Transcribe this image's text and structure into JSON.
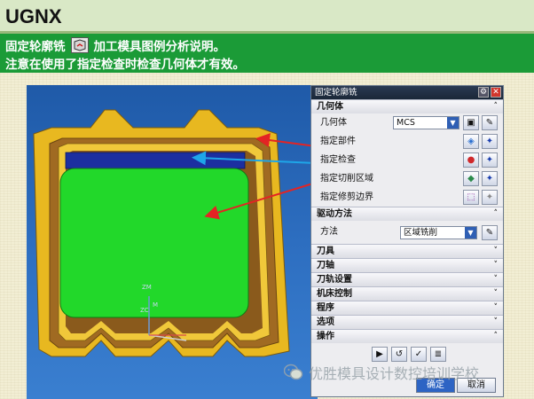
{
  "header": {
    "title": "UGNX"
  },
  "banner": {
    "line1_prefix": "固定轮廓铣",
    "line1_suffix": "加工模具图例分析说明。",
    "line2": "注意在使用了指定检查时检查几何体才有效。"
  },
  "viewport": {
    "axis_zm": "ZM",
    "axis_z": "ZC",
    "axis_m": "M"
  },
  "dialog": {
    "title": "固定轮廓铣",
    "geometry_section": "几何体",
    "geometry_label": "几何体",
    "geometry_value": "MCS",
    "specify_part": "指定部件",
    "specify_check": "指定检查",
    "specify_cut_area": "指定切削区域",
    "specify_trim": "指定修剪边界",
    "drive_section": "驱动方法",
    "method_label": "方法",
    "method_value": "区域铣削",
    "collapsed_sections": [
      "刀具",
      "刀轴",
      "刀轨设置",
      "机床控制",
      "程序",
      "选项"
    ],
    "ops_section": "操作",
    "ok": "确定",
    "cancel": "取消"
  },
  "watermark": "优胜模具设计数控培训学校",
  "colors": {
    "banner": "#1b9b37",
    "part": "#e8b820",
    "cut_area": "#22d82a",
    "check_band": "#1c2fa0",
    "red_arrow": "#e32424",
    "blue_arrow": "#1ea6e8"
  }
}
